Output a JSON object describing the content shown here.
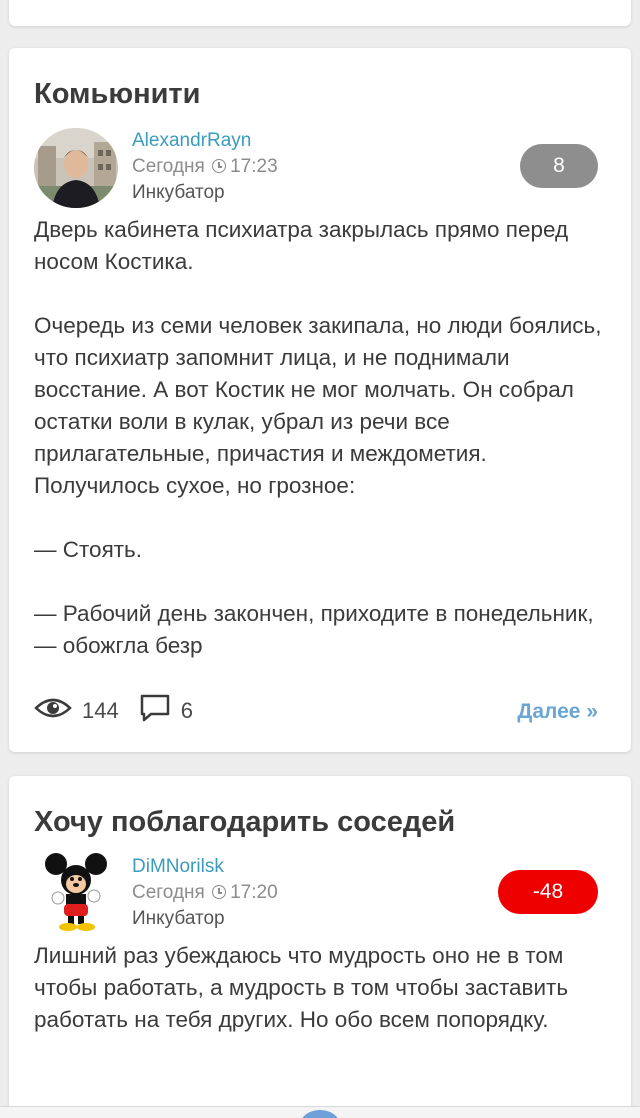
{
  "posts": [
    {
      "title": "Комьюнити",
      "author": "AlexandrRayn",
      "date_label": "Сегодня",
      "time": "17:23",
      "category": "Инкубатор",
      "rating": "8",
      "paragraphs": [
        "Дверь кабинета психиатра закрылась прямо перед носом Костика.",
        "Очередь из семи человек закипала, но люди боялись, что психиатр запомнит лица, и не поднимали восстание. А вот Костик не мог молчать. Он собрал остатки воли в кулак, убрал из речи все прилагательные, причастия и междометия. Получилось сухое, но грозное:",
        "— Стоять.",
        "— Рабочий день закончен, приходите в понедельник, — обожгла безр"
      ],
      "views": "144",
      "comments": "6",
      "more_label": "Далее »"
    },
    {
      "title": "Хочу поблагодарить соседей",
      "author": "DiMNorilsk",
      "date_label": "Сегодня",
      "time": "17:20",
      "category": "Инкубатор",
      "rating": "-48",
      "paragraphs": [
        "Лишний раз убеждаюсь что мудрость оно не в том чтобы работать, а мудрость в том чтобы заставить работать на тебя других. Но обо всем попорядку."
      ]
    }
  ],
  "icons": {
    "views": "eye-icon",
    "comments": "comment-icon",
    "time": "clock-icon"
  },
  "colors": {
    "author": "#3a9bbd",
    "rating_neutral": "#8e8e8e",
    "rating_negative": "#ef0000",
    "more_link": "#6aa5d4"
  }
}
